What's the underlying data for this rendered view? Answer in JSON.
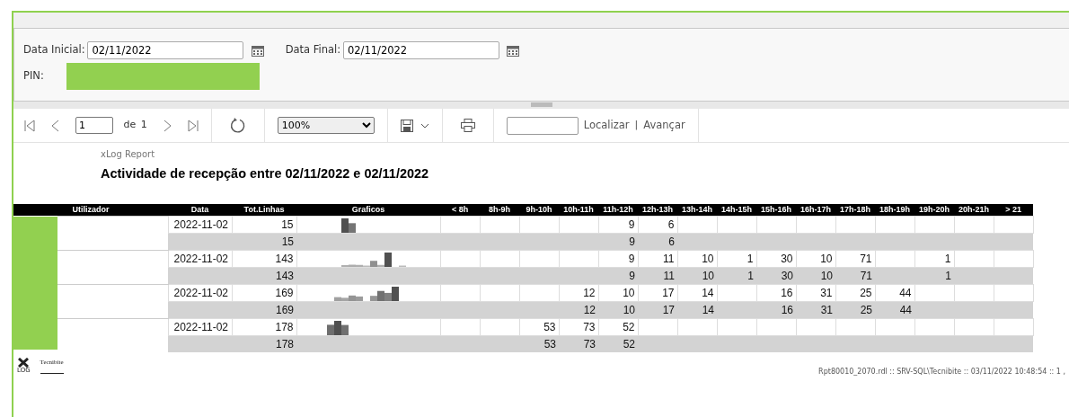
{
  "parameters": [
    {
      "label": "Data Inicial:",
      "value": "02/11/2022"
    },
    {
      "label": "Data Final:",
      "value": "02/11/2022"
    }
  ],
  "pin": {
    "label": "PIN:",
    "redacted": true
  },
  "toolbar": {
    "page": "1",
    "of_label": "de",
    "page_count": "1",
    "zoom": "100%",
    "find_label": "Localizar",
    "separator": "|",
    "next_label": "Avançar"
  },
  "report": {
    "brand": "xLog Report",
    "title": "Actividade de recepção entre 02/11/2022 e 02/11/2022",
    "columns": [
      "Utilizador",
      "Data",
      "Tot.Linhas",
      "Graficos",
      "< 8h",
      "8h-9h",
      "9h-10h",
      "10h-11h",
      "11h-12h",
      "12h-13h",
      "13h-14h",
      "14h-15h",
      "15h-16h",
      "16h-17h",
      "17h-18h",
      "18h-19h",
      "19h-20h",
      "20h-21h",
      "> 21"
    ],
    "user_redacted": true,
    "groups": [
      {
        "detail": {
          "date": "2022-11-02",
          "total": "15",
          "hours": {
            "h11_12": "9",
            "h12_13": "6"
          }
        },
        "subtotal": {
          "total": "15",
          "hours": {
            "h11_12": "9",
            "h12_13": "6"
          }
        }
      },
      {
        "detail": {
          "date": "2022-11-02",
          "total": "143",
          "hours": {
            "h11_12": "9",
            "h12_13": "11",
            "h13_14": "10",
            "h14_15": "1",
            "h15_16": "30",
            "h16_17": "10",
            "h17_18": "71",
            "h19_20": "1"
          }
        },
        "subtotal": {
          "total": "143",
          "hours": {
            "h11_12": "9",
            "h12_13": "11",
            "h13_14": "10",
            "h14_15": "1",
            "h15_16": "30",
            "h16_17": "10",
            "h17_18": "71",
            "h19_20": "1"
          }
        }
      },
      {
        "detail": {
          "date": "2022-11-02",
          "total": "169",
          "hours": {
            "h10_11": "12",
            "h11_12": "10",
            "h12_13": "17",
            "h13_14": "14",
            "h15_16": "16",
            "h16_17": "31",
            "h17_18": "25",
            "h18_19": "44"
          }
        },
        "subtotal": {
          "total": "169",
          "hours": {
            "h10_11": "12",
            "h11_12": "10",
            "h12_13": "17",
            "h13_14": "14",
            "h15_16": "16",
            "h16_17": "31",
            "h17_18": "25",
            "h18_19": "44"
          }
        }
      },
      {
        "detail": {
          "date": "2022-11-02",
          "total": "178",
          "hours": {
            "h9_10": "53",
            "h10_11": "73",
            "h11_12": "52"
          }
        },
        "subtotal": {
          "total": "178",
          "hours": {
            "h9_10": "53",
            "h10_11": "73",
            "h11_12": "52"
          }
        }
      }
    ]
  },
  "footer": {
    "logo_text": "LOG",
    "company": "Tecnibite",
    "info": "Rpt80010_2070.rdl :: SRV-SQL\\Tecnibite :: 03/11/2022 10:48:54 :: 1 ,"
  }
}
